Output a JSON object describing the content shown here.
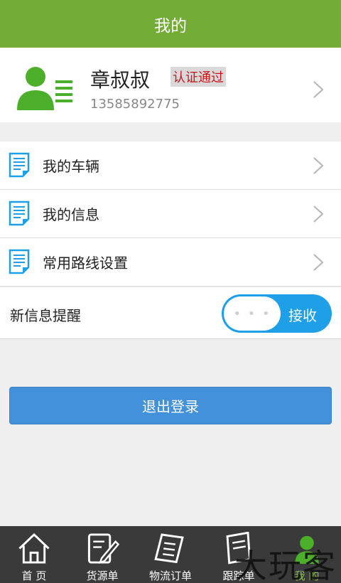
{
  "header": {
    "title": "我的"
  },
  "profile": {
    "name": "章叔叔",
    "verify_status": "认证通过",
    "phone": "13585892775"
  },
  "menu": {
    "items": [
      {
        "label": "我的车辆"
      },
      {
        "label": "我的信息"
      },
      {
        "label": "常用路线设置"
      }
    ]
  },
  "notify": {
    "label": "新信息提醒",
    "toggle_state": "接收",
    "knob_text": "• • •"
  },
  "logout": {
    "label": "退出登录"
  },
  "tabbar": {
    "tabs": [
      {
        "label": "首 页",
        "icon": "home-icon"
      },
      {
        "label": "货源单",
        "icon": "edit-document-icon"
      },
      {
        "label": "物流订单",
        "icon": "order-list-icon"
      },
      {
        "label": "跟踪单",
        "icon": "tracking-doc-icon"
      },
      {
        "label": "我 的",
        "icon": "user-icon"
      }
    ],
    "active_index": 4
  },
  "watermark": {
    "text": "大玩客"
  },
  "colors": {
    "header_green": "#74ad35",
    "toggle_blue": "#1e9fe8",
    "button_blue": "#4390db",
    "verify_red": "#c8141c",
    "avatar_green": "#4caf2a"
  }
}
